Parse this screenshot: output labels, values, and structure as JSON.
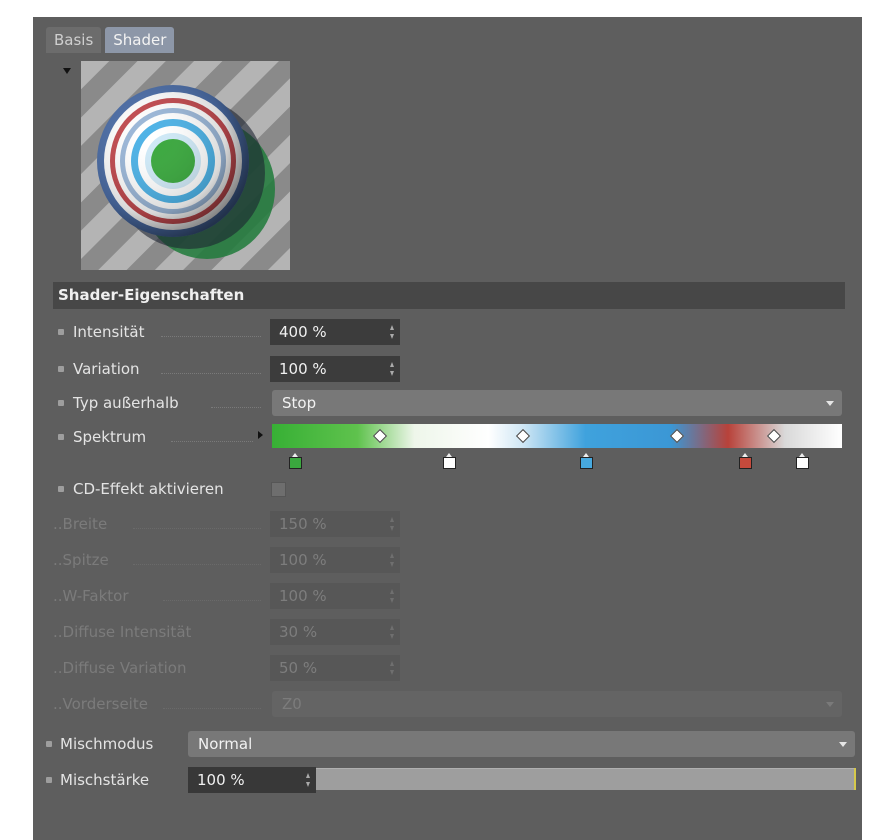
{
  "tabs": [
    {
      "label": "Basis",
      "active": false
    },
    {
      "label": "Shader",
      "active": true
    }
  ],
  "preview": {
    "icon": "material-preview-sphere",
    "ring_colors": [
      "#3aa83e",
      "#ffffff",
      "#4fb4e8",
      "#ffffff",
      "#c84848",
      "#ffffff",
      "#5a7fc0"
    ]
  },
  "section": {
    "title": "Shader-Eigenschaften"
  },
  "fields": {
    "intensitaet": {
      "label": "Intensität",
      "value": "400 %"
    },
    "variation": {
      "label": "Variation",
      "value": "100 %"
    },
    "typ": {
      "label": "Typ außerhalb",
      "value": "Stop"
    },
    "spektrum": {
      "label": "Spektrum"
    },
    "cd_effekt": {
      "label": "CD-Effekt aktivieren",
      "checked": false
    },
    "breite": {
      "label": "..Breite",
      "value": "150 %"
    },
    "spitze": {
      "label": "..Spitze",
      "value": "100 %"
    },
    "w_faktor": {
      "label": "..W-Faktor",
      "value": "100 %"
    },
    "diffuse_int": {
      "label": "..Diffuse Intensität",
      "value": "30 %"
    },
    "diffuse_var": {
      "label": "..Diffuse Variation",
      "value": "50 %"
    },
    "vorderseite": {
      "label": "..Vorderseite",
      "value": "Z0"
    },
    "mischmodus": {
      "label": "Mischmodus",
      "value": "Normal"
    },
    "mischstaerke": {
      "label": "Mischstärke",
      "value": "100 %",
      "level": 1.0
    }
  },
  "spectrum": {
    "knots": [
      {
        "color": "#3aa83e",
        "position": 0.04
      },
      {
        "color": "#ffffff",
        "position": 0.31
      },
      {
        "color": "#47a9df",
        "position": 0.55
      },
      {
        "color": "#c64a3c",
        "position": 0.83
      },
      {
        "color": "#ffffff",
        "position": 0.93
      }
    ],
    "interpolation_markers": [
      0.19,
      0.44,
      0.71,
      0.88
    ]
  },
  "colors": {
    "panel": "#5e5e5e",
    "active_tab": "#8d97a8",
    "field": "#3c3c3c"
  }
}
